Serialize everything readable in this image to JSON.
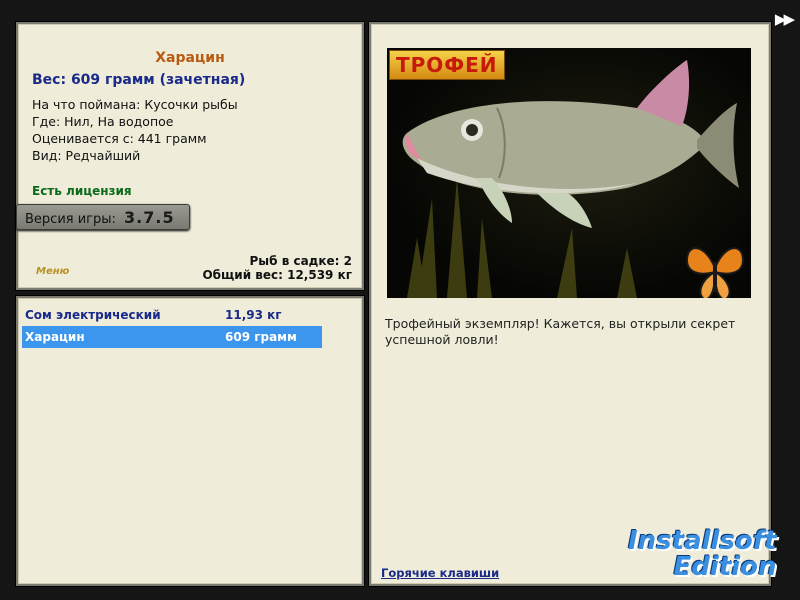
{
  "info": {
    "fish_name": "Харацин",
    "weight_line": "Вес: 609 грамм (зачетная)",
    "bait_line": "На что поймана: Кусочки рыбы",
    "location_line": "Где: Нил, На водопое",
    "rated_line": "Оценивается с: 441 грамм",
    "kind_line": "Вид: Редчайший",
    "license": "Есть лицензия",
    "version_label": "Версия игры:",
    "version_value": "3.7.5",
    "menu_label": "Меню",
    "fish_in_keep": "Рыб в садке: 2",
    "total_weight": "Общий вес: 12,539 кг"
  },
  "catch_list": [
    {
      "name": "Сом электрический",
      "weight": "11,93 кг",
      "selected": false
    },
    {
      "name": "Харацин",
      "weight": "609 грамм",
      "selected": true
    }
  ],
  "detail": {
    "trophy_label": "ТРОФЕЙ",
    "description": "Трофейный экземпляр! Кажется, вы открыли секрет успешной ловли!",
    "hotkeys": "Горячие клавиши"
  },
  "nav": {
    "forward_icon": "fast-forward-icon",
    "forward_glyph": "▶▶"
  },
  "watermark": {
    "line1": "Installsoft",
    "line2": "Edition"
  },
  "colors": {
    "panel_bg": "#efecd9",
    "fish_name": "#b85a10",
    "weight": "#1a2a8a",
    "license": "#0a6a1a",
    "selection": "#3d96ee"
  }
}
